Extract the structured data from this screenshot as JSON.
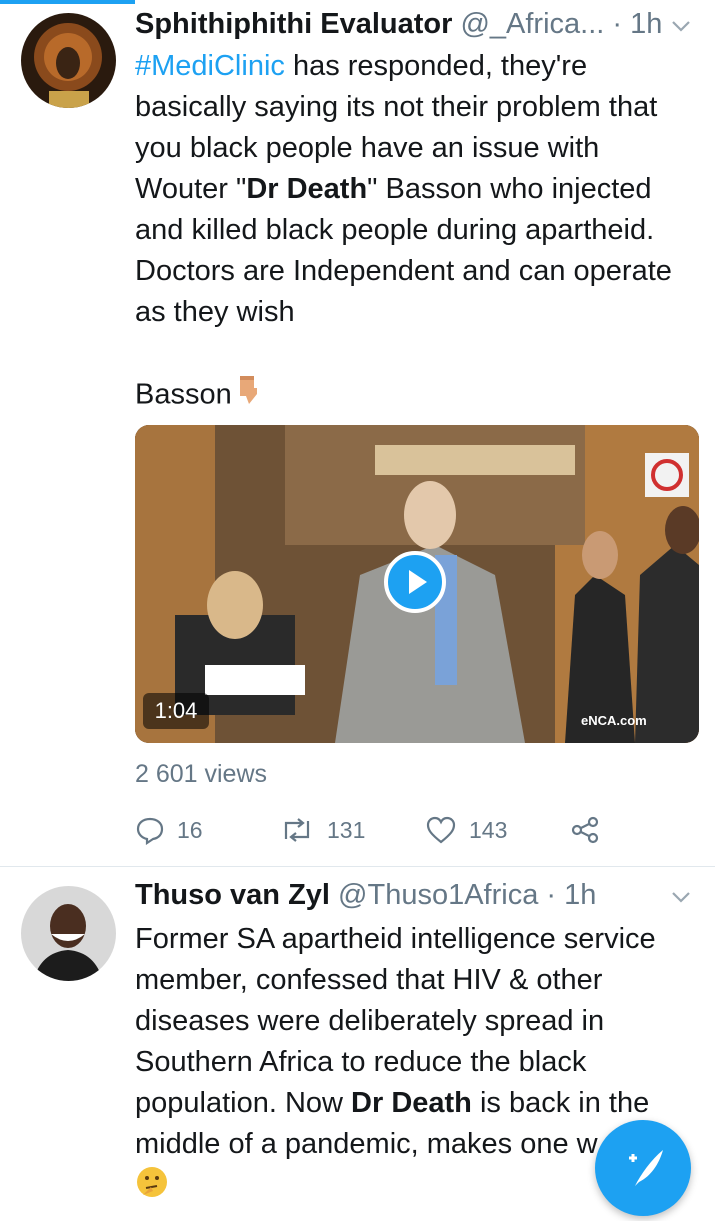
{
  "tweets": [
    {
      "author_name": "Sphithiphithi Evaluator",
      "handle": "@_Africa...",
      "time": "· 1h",
      "hashtag": "#MediClinic",
      "text_part1": " has responded, they're basically saying its not their problem that you black people have an issue with Wouter \"",
      "text_bold": "Dr Death",
      "text_part2": "\" Basson who injected and killed black people during apartheid. Doctors are Independent and can operate as they wish",
      "text_line2": "Basson",
      "video": {
        "duration": "1:04",
        "watermark": "eNCA.com"
      },
      "views": "2 601 views",
      "actions": {
        "replies": "16",
        "retweets": "131",
        "likes": "143"
      }
    },
    {
      "author_name": "Thuso van Zyl",
      "handle": "@Thuso1Africa",
      "time": "· 1h",
      "text_part1": "Former SA apartheid intelligence service member, confessed that HIV & other diseases were deliberately spread in Southern Africa to reduce the black population. Now ",
      "text_bold": "Dr Death",
      "text_part2": " is back in the middle of a pandemic, makes one w"
    }
  ],
  "colors": {
    "accent": "#1da1f2",
    "muted": "#657786",
    "text": "#14171a"
  },
  "icons": [
    "chevron-down-icon",
    "reply-icon",
    "retweet-icon",
    "like-icon",
    "share-icon",
    "play-icon",
    "compose-icon",
    "pointing-down-emoji",
    "thinking-face-emoji"
  ]
}
